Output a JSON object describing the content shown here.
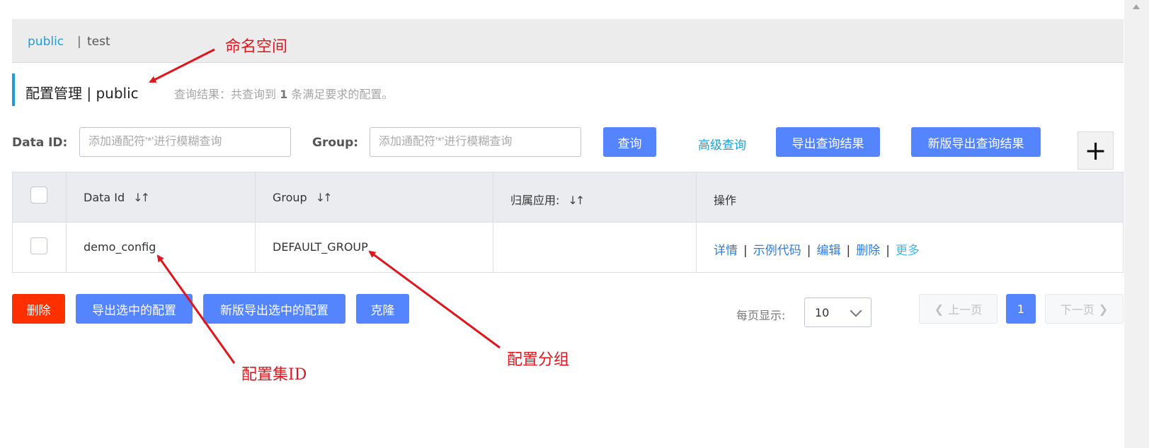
{
  "namespace_bar": {
    "items": [
      {
        "label": "public",
        "active": true
      },
      {
        "label": "test",
        "active": false
      }
    ],
    "separator": "|"
  },
  "title": {
    "text": "配置管理 | public",
    "query_result_prefix": "查询结果：共查询到",
    "query_result_count": "1",
    "query_result_suffix": "条满足要求的配置。"
  },
  "filters": {
    "data_id_label": "Data ID:",
    "data_id_placeholder": "添加通配符'*'进行模糊查询",
    "group_label": "Group:",
    "group_placeholder": "添加通配符'*'进行模糊查询",
    "query_button": "查询",
    "advanced_query": "高级查询",
    "export_button": "导出查询结果",
    "new_export_button": "新版导出查询结果",
    "add_button": "+"
  },
  "table": {
    "headers": [
      "Data Id",
      "Group",
      "归属应用:",
      "操作"
    ],
    "sort_icon": "sort-icon",
    "rows": [
      {
        "data_id": "demo_config",
        "group": "DEFAULT_GROUP",
        "app": "",
        "ops": [
          "详情",
          "示例代码",
          "编辑",
          "删除",
          "更多"
        ]
      }
    ]
  },
  "bulk_actions": {
    "delete": "删除",
    "export_selected": "导出选中的配置",
    "new_export_selected": "新版导出选中的配置",
    "clone": "克隆"
  },
  "pagination": {
    "per_page_label": "每页显示:",
    "per_page_value": "10",
    "prev": "上一页",
    "current": "1",
    "next": "下一页"
  },
  "annotations": {
    "namespace": "命名空间",
    "data_id": "配置集ID",
    "group": "配置分组"
  },
  "colors": {
    "primary": "#5584ff",
    "danger": "#ff3000",
    "link": "#1ba1d8",
    "annotation": "#e0161d"
  }
}
